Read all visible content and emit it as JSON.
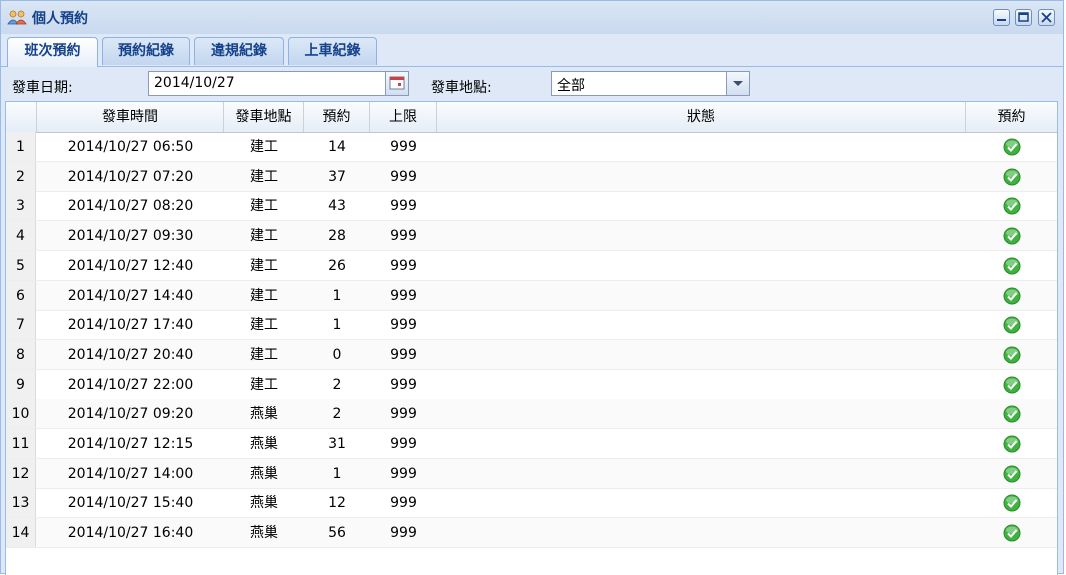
{
  "window": {
    "title": "個人預約",
    "icons": {
      "title": "users-icon",
      "minimize": "minimize-icon",
      "maximize": "maximize-icon",
      "close": "close-icon"
    }
  },
  "tabs": [
    {
      "label": "班次預約",
      "active": true
    },
    {
      "label": "預約紀錄",
      "active": false
    },
    {
      "label": "違規紀錄",
      "active": false
    },
    {
      "label": "上車紀錄",
      "active": false
    }
  ],
  "filter": {
    "date_label": "發車日期:",
    "date_value": "2014/10/27",
    "location_label": "發車地點:",
    "location_value": "全部",
    "icons": {
      "date_trigger": "calendar-icon",
      "location_trigger": "chevron-down-icon"
    }
  },
  "grid": {
    "headers": [
      "發車時間",
      "發車地點",
      "預約",
      "上限",
      "狀態",
      "預約"
    ],
    "row_action_icon": "check-circle-icon",
    "accent": "#3eb23e",
    "rows": [
      {
        "n": "1",
        "time": "2014/10/27 06:50",
        "place": "建工",
        "count": "14",
        "limit": "999",
        "status": ""
      },
      {
        "n": "2",
        "time": "2014/10/27 07:20",
        "place": "建工",
        "count": "37",
        "limit": "999",
        "status": ""
      },
      {
        "n": "3",
        "time": "2014/10/27 08:20",
        "place": "建工",
        "count": "43",
        "limit": "999",
        "status": ""
      },
      {
        "n": "4",
        "time": "2014/10/27 09:30",
        "place": "建工",
        "count": "28",
        "limit": "999",
        "status": ""
      },
      {
        "n": "5",
        "time": "2014/10/27 12:40",
        "place": "建工",
        "count": "26",
        "limit": "999",
        "status": ""
      },
      {
        "n": "6",
        "time": "2014/10/27 14:40",
        "place": "建工",
        "count": "1",
        "limit": "999",
        "status": ""
      },
      {
        "n": "7",
        "time": "2014/10/27 17:40",
        "place": "建工",
        "count": "1",
        "limit": "999",
        "status": ""
      },
      {
        "n": "8",
        "time": "2014/10/27 20:40",
        "place": "建工",
        "count": "0",
        "limit": "999",
        "status": ""
      },
      {
        "n": "9",
        "time": "2014/10/27 22:00",
        "place": "建工",
        "count": "2",
        "limit": "999",
        "status": ""
      },
      {
        "n": "10",
        "time": "2014/10/27 09:20",
        "place": "燕巢",
        "count": "2",
        "limit": "999",
        "status": ""
      },
      {
        "n": "11",
        "time": "2014/10/27 12:15",
        "place": "燕巢",
        "count": "31",
        "limit": "999",
        "status": ""
      },
      {
        "n": "12",
        "time": "2014/10/27 14:00",
        "place": "燕巢",
        "count": "1",
        "limit": "999",
        "status": ""
      },
      {
        "n": "13",
        "time": "2014/10/27 15:40",
        "place": "燕巢",
        "count": "12",
        "limit": "999",
        "status": ""
      },
      {
        "n": "14",
        "time": "2014/10/27 16:40",
        "place": "燕巢",
        "count": "56",
        "limit": "999",
        "status": ""
      }
    ]
  }
}
